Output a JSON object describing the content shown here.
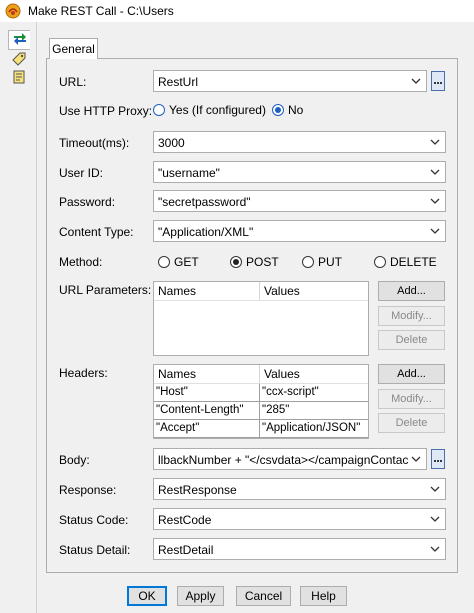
{
  "window": {
    "title": "Make REST Call - C:\\Users"
  },
  "side_tabs": [
    "arrows-icon",
    "tag-icon",
    "document-icon"
  ],
  "tabs": [
    {
      "label": "General"
    }
  ],
  "fields": {
    "url": {
      "label": "URL:",
      "value": "RestUrl"
    },
    "proxy": {
      "label": "Use HTTP Proxy:",
      "options": [
        "Yes (If configured)",
        "No"
      ],
      "selected": "No"
    },
    "timeout": {
      "label": "Timeout(ms):",
      "value": "3000"
    },
    "user_id": {
      "label": "User ID:",
      "value": "\"username\""
    },
    "password": {
      "label": "Password:",
      "value": "\"secretpassword\""
    },
    "content_type": {
      "label": "Content Type:",
      "value": "\"Application/XML\""
    },
    "method": {
      "label": "Method:",
      "options": [
        "GET",
        "POST",
        "PUT",
        "DELETE"
      ],
      "selected": "POST"
    },
    "body": {
      "label": "Body:",
      "value": "llbackNumber + \"</csvdata></campaignContacts>\""
    },
    "response": {
      "label": "Response:",
      "value": "RestResponse"
    },
    "status_code": {
      "label": "Status Code:",
      "value": "RestCode"
    },
    "status_detail": {
      "label": "Status Detail:",
      "value": "RestDetail"
    }
  },
  "url_parameters": {
    "label": "URL Parameters:",
    "columns": [
      "Names",
      "Values"
    ],
    "rows": [],
    "buttons": {
      "add": "Add...",
      "modify": "Modify...",
      "delete": "Delete"
    }
  },
  "headers": {
    "label": "Headers:",
    "columns": [
      "Names",
      "Values"
    ],
    "rows": [
      {
        "name": "\"Host\"",
        "value": "\"ccx-script\""
      },
      {
        "name": "\"Content-Length\"",
        "value": "\"285\""
      },
      {
        "name": "\"Accept\"",
        "value": "\"Application/JSON\""
      }
    ],
    "buttons": {
      "add": "Add...",
      "modify": "Modify...",
      "delete": "Delete"
    }
  },
  "dialog_buttons": {
    "ok": "OK",
    "apply": "Apply",
    "cancel": "Cancel",
    "help": "Help"
  },
  "colors": {
    "accent": "#1e5fc2",
    "focus_border": "#0078d7"
  }
}
